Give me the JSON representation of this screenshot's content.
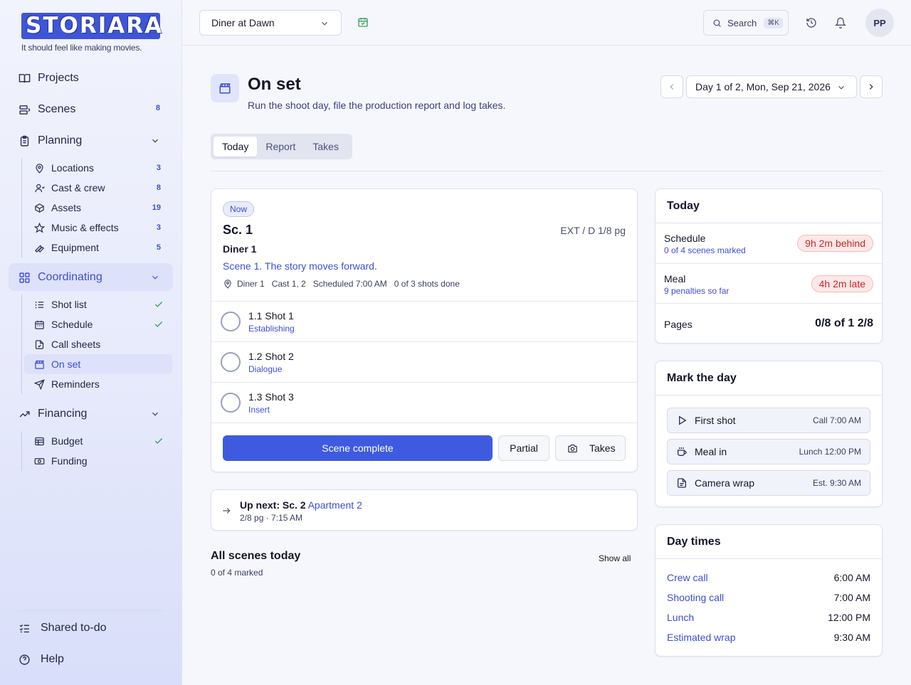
{
  "brand": {
    "logo_text": "STORIARA",
    "tagline": "It should feel like making movies."
  },
  "sidebar": {
    "projects": "Projects",
    "scenes": {
      "label": "Scenes",
      "count": "8"
    },
    "planning": {
      "label": "Planning",
      "items": [
        {
          "label": "Locations",
          "count": "3"
        },
        {
          "label": "Cast & crew",
          "count": "8"
        },
        {
          "label": "Assets",
          "count": "19"
        },
        {
          "label": "Music & effects",
          "count": "3"
        },
        {
          "label": "Equipment",
          "count": "5"
        }
      ]
    },
    "coordinating": {
      "label": "Coordinating",
      "items": [
        {
          "label": "Shot list",
          "done": true
        },
        {
          "label": "Schedule",
          "done": true
        },
        {
          "label": "Call sheets",
          "done": false
        },
        {
          "label": "On set",
          "done": false,
          "active": true
        },
        {
          "label": "Reminders",
          "done": false
        }
      ]
    },
    "financing": {
      "label": "Financing",
      "items": [
        {
          "label": "Budget",
          "done": true
        },
        {
          "label": "Funding",
          "done": false
        }
      ]
    },
    "shared_todo": "Shared to-do",
    "help": "Help"
  },
  "topbar": {
    "project": "Diner at Dawn",
    "search_label": "Search",
    "search_kbd": "⌘K",
    "avatar": "PP"
  },
  "header": {
    "title": "On set",
    "subtitle": "Run the shoot day, file the production report and log takes.",
    "day_select": "Day 1 of 2, Mon, Sep 21, 2026"
  },
  "tabs": [
    "Today",
    "Report",
    "Takes"
  ],
  "current_scene": {
    "badge": "Now",
    "title": "Sc. 1",
    "meta": "EXT / D 1/8 pg",
    "location": "Diner 1",
    "description": "Scene 1. The story moves forward.",
    "info": {
      "location": "Diner 1",
      "cast": "Cast 1, 2",
      "scheduled": "Scheduled 7:00 AM",
      "shots": "0 of 3 shots done"
    },
    "shots": [
      {
        "name": "1.1 Shot 1",
        "type": "Establishing"
      },
      {
        "name": "1.2 Shot 2",
        "type": "Dialogue"
      },
      {
        "name": "1.3 Shot 3",
        "type": "Insert"
      }
    ],
    "actions": {
      "complete": "Scene complete",
      "partial": "Partial",
      "takes": "Takes"
    }
  },
  "up_next": {
    "label": "Up next: Sc. 2",
    "location": "Apartment 2",
    "meta": "2/8 pg · 7:15 AM"
  },
  "all_scenes": {
    "title": "All scenes today",
    "sub": "0 of 4 marked",
    "show_all": "Show all"
  },
  "today_panel": {
    "title": "Today",
    "schedule": {
      "label": "Schedule",
      "sub": "0 of 4 scenes marked",
      "status": "9h 2m behind"
    },
    "meal": {
      "label": "Meal",
      "sub": "9 penalties so far",
      "status": "4h 2m late"
    },
    "pages": {
      "label": "Pages",
      "value": "0/8 of 1 2/8"
    },
    "colors": {
      "danger": "#c62828",
      "accent": "#3e5be0",
      "success": "#2f9e55"
    }
  },
  "mark_day": {
    "title": "Mark the day",
    "buttons": [
      {
        "label": "First shot",
        "meta": "Call 7:00 AM",
        "icon": "play-icon"
      },
      {
        "label": "Meal in",
        "meta": "Lunch 12:00 PM",
        "icon": "coffee-icon"
      },
      {
        "label": "Camera wrap",
        "meta": "Est. 9:30 AM",
        "icon": "document-icon"
      }
    ]
  },
  "day_times": {
    "title": "Day times",
    "rows": [
      {
        "label": "Crew call",
        "value": "6:00 AM"
      },
      {
        "label": "Shooting call",
        "value": "7:00 AM"
      },
      {
        "label": "Lunch",
        "value": "12:00 PM"
      },
      {
        "label": "Estimated wrap",
        "value": "9:30 AM"
      }
    ]
  }
}
